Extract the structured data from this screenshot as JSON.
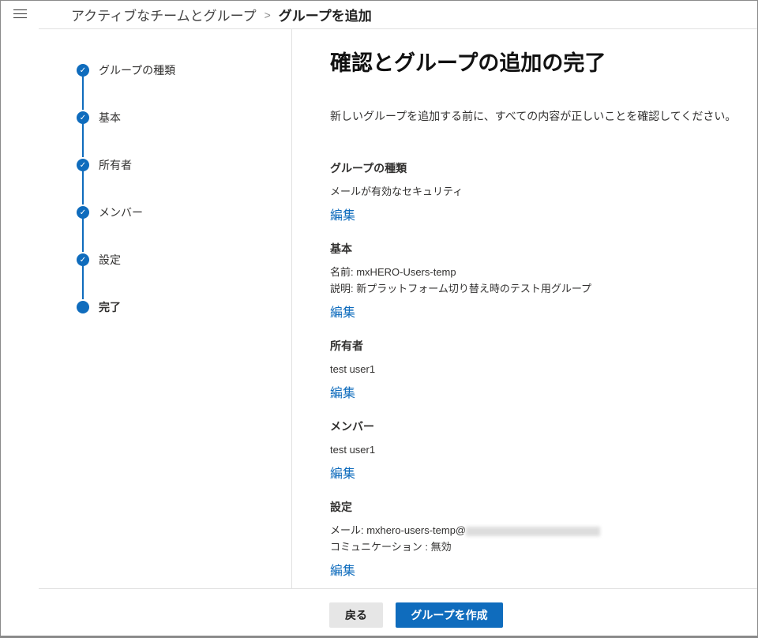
{
  "breadcrumb": {
    "parent": "アクティブなチームとグループ",
    "current": "グループを追加"
  },
  "steps": [
    {
      "label": "グループの種類",
      "state": "done"
    },
    {
      "label": "基本",
      "state": "done"
    },
    {
      "label": "所有者",
      "state": "done"
    },
    {
      "label": "メンバー",
      "state": "done"
    },
    {
      "label": "設定",
      "state": "done"
    },
    {
      "label": "完了",
      "state": "current"
    }
  ],
  "main": {
    "title": "確認とグループの追加の完了",
    "intro": "新しいグループを追加する前に、すべての内容が正しいことを確認してください。",
    "edit_label": "編集",
    "sections": [
      {
        "heading": "グループの種類",
        "lines": [
          "メールが有効なセキュリティ"
        ]
      },
      {
        "heading": "基本",
        "lines": [
          "名前: mxHERO-Users-temp",
          "説明: 新プラットフォーム切り替え時のテスト用グループ"
        ]
      },
      {
        "heading": "所有者",
        "lines": [
          "test user1"
        ]
      },
      {
        "heading": "メンバー",
        "lines": [
          "test user1"
        ]
      },
      {
        "heading": "設定",
        "lines": [
          "メール: mxhero-users-temp@",
          "コミュニケーション : 無効"
        ]
      }
    ]
  },
  "footer": {
    "back": "戻る",
    "create": "グループを作成"
  },
  "colors": {
    "accent": "#0f6cbd"
  }
}
